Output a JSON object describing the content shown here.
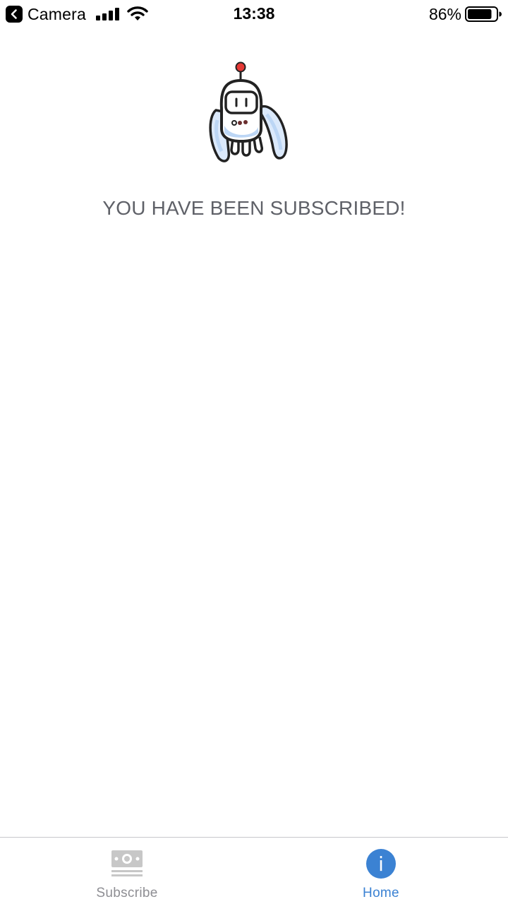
{
  "status_bar": {
    "back_app_label": "Camera",
    "time": "13:38",
    "battery_percent": "86%",
    "battery_level": 0.86,
    "signal_bars": 4,
    "icons": {
      "back": "chevron-left-icon",
      "signal": "cellular-signal-icon",
      "wifi": "wifi-icon",
      "battery": "battery-icon"
    }
  },
  "main": {
    "mascot_icon": "robot-mascot-icon",
    "headline": "YOU HAVE BEEN SUBSCRIBED!"
  },
  "tab_bar": {
    "tabs": [
      {
        "label": "Subscribe",
        "icon": "money-icon",
        "active": false
      },
      {
        "label": "Home",
        "icon": "info-icon",
        "glyph": "i",
        "active": true
      }
    ]
  },
  "colors": {
    "accent": "#3b82d3",
    "headline_text": "#5f6168",
    "inactive_tab": "#8e8e93",
    "divider": "#c7c7cc",
    "mascot_antenna": "#e53935",
    "mascot_shading": "#bcd6f5"
  }
}
